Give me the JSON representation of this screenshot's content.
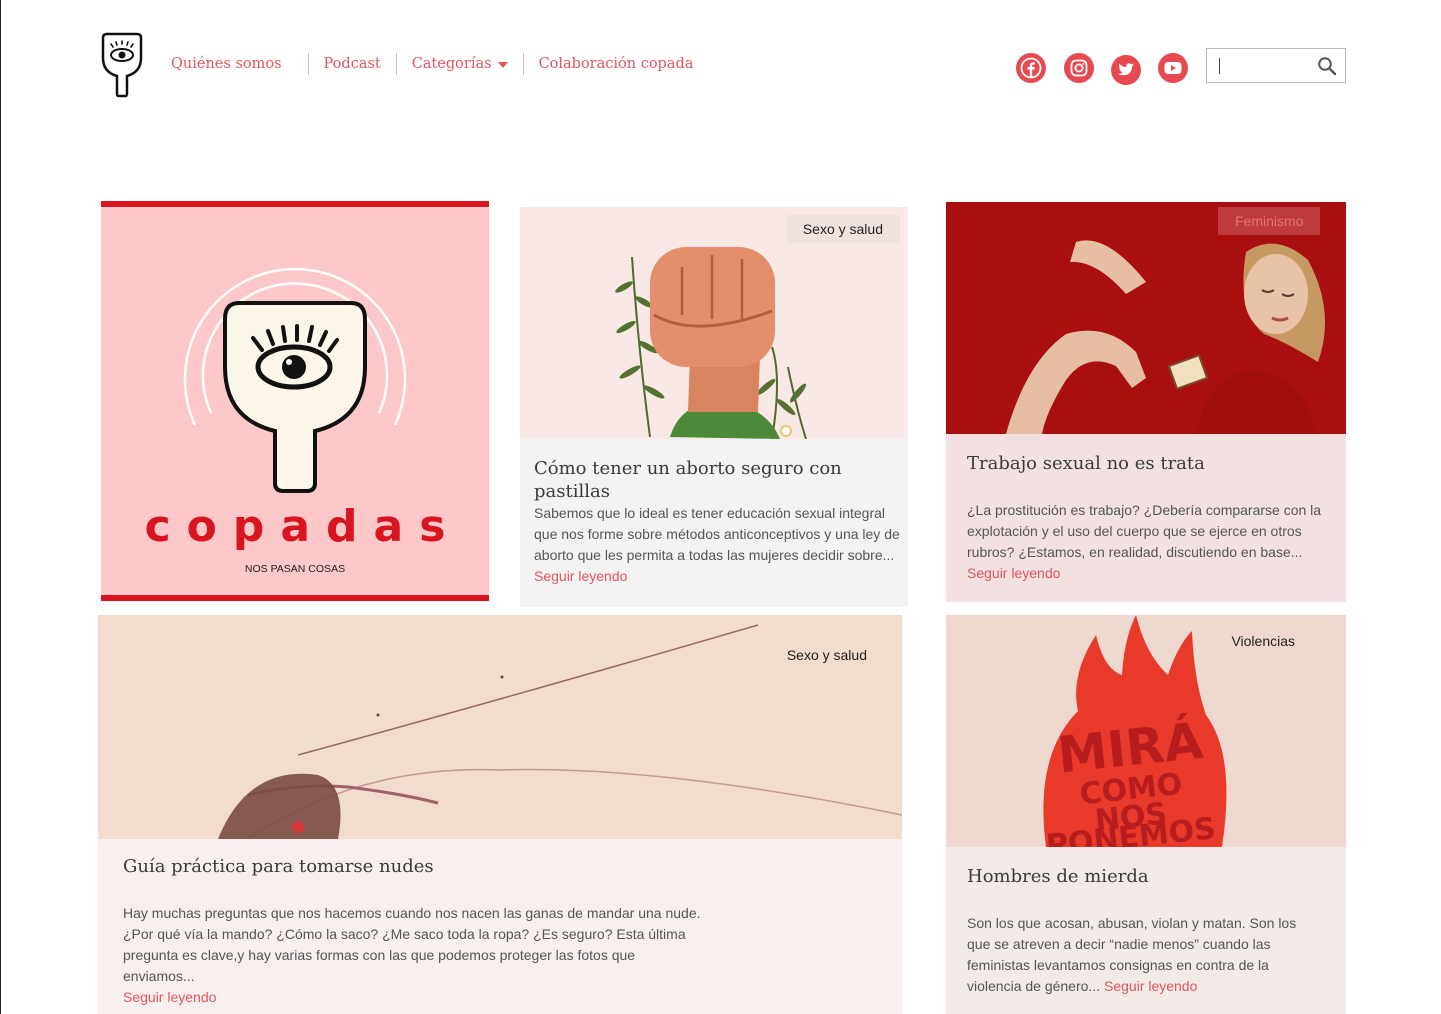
{
  "nav": {
    "items": [
      {
        "label": "Quiénes somos"
      },
      {
        "label": "Podcast"
      },
      {
        "label": "Categorías"
      },
      {
        "label": "Colaboración copada"
      }
    ]
  },
  "social": [
    "facebook-icon",
    "instagram-icon",
    "twitter-icon",
    "youtube-icon"
  ],
  "search": {
    "placeholder": ""
  },
  "colors": {
    "accent": "#e0555c",
    "brand_red": "#d8151f",
    "social_red": "#e8484f"
  },
  "podcast_cover": {
    "wordmark": "copadas",
    "subtitle": "NOS PASAN COSAS"
  },
  "articles": [
    {
      "category": "Sexo y salud",
      "title": "Cómo tener un aborto seguro con pastillas",
      "excerpt": "Sabemos que lo ideal es tener educación sexual integral que nos forme sobre métodos anticonceptivos y una ley de aborto que les permita a todas las mujeres decidir sobre...",
      "more": "Seguir leyendo"
    },
    {
      "category": "Feminismo",
      "title": "Trabajo sexual no es trata",
      "excerpt": "¿La prostitución es trabajo? ¿Debería compararse con la explotación y el uso del cuerpo que se ejerce en otros rubros? ¿Estamos, en realidad, discutiendo en base...",
      "more": "Seguir leyendo"
    },
    {
      "category": "Sexo y salud",
      "title": "Guía práctica para tomarse nudes",
      "excerpt": "Hay muchas preguntas que nos hacemos cuando nos nacen las ganas de mandar una nude. ¿Por qué vía la mando? ¿Cómo la saco? ¿Me saco toda la ropa? ¿Es seguro? Esta última pregunta es clave,y hay varias formas con las que podemos proteger las fotos que enviamos...",
      "more": "Seguir leyendo"
    },
    {
      "category": "Violencias",
      "title": "Hombres de mierda",
      "excerpt": "Son los que acosan, abusan, violan y matan. Son los que se atreven a decir “nadie menos” cuando las feministas levantamos consignas en contra de la violencia de género...",
      "more": "Seguir leyendo",
      "poster_text": [
        "MIRÁ",
        "COMO",
        "NOS",
        "PONEMOS"
      ]
    }
  ]
}
